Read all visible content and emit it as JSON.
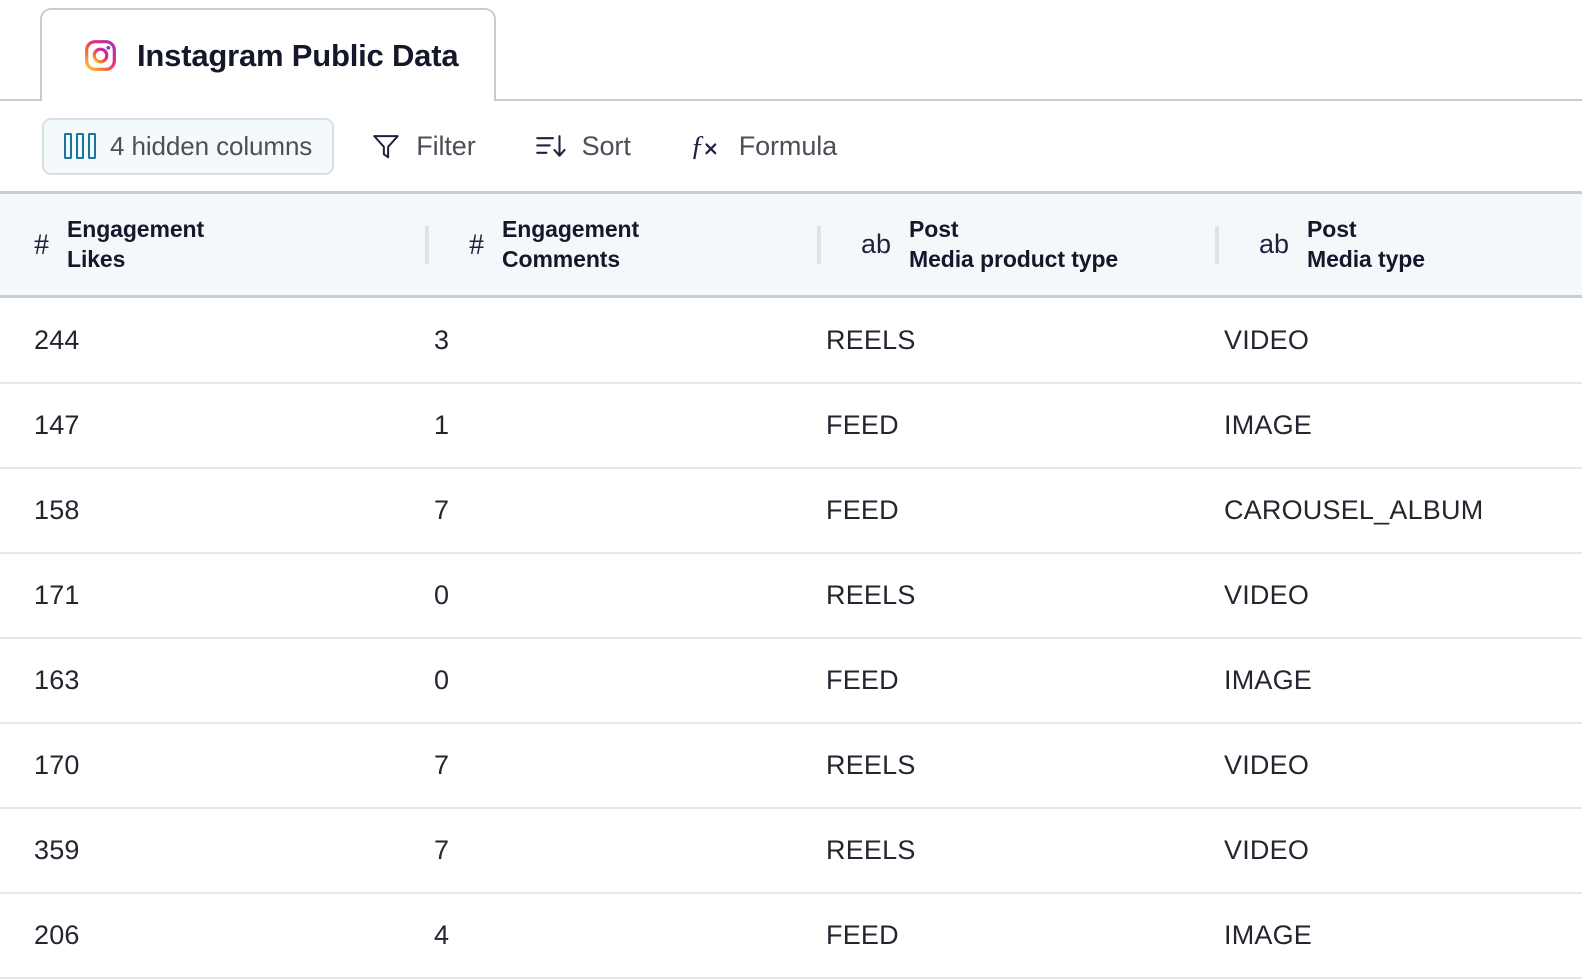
{
  "tab": {
    "title": "Instagram Public Data",
    "icon": "instagram-icon"
  },
  "toolbar": {
    "hidden_columns": {
      "label": "4 hidden columns",
      "icon": "columns-icon",
      "active": true,
      "accent_color": "#16769e",
      "background": "#f4fafc"
    },
    "filter": {
      "label": "Filter",
      "icon": "funnel-icon"
    },
    "sort": {
      "label": "Sort",
      "icon": "sort-descending-icon"
    },
    "formula": {
      "label": "Formula",
      "icon": "function-icon"
    }
  },
  "table": {
    "columns": [
      {
        "type_icon": "#",
        "group": "Engagement",
        "name": "Likes"
      },
      {
        "type_icon": "#",
        "group": "Engagement",
        "name": "Comments"
      },
      {
        "type_icon": "ab",
        "group": "Post",
        "name": "Media product type"
      },
      {
        "type_icon": "ab",
        "group": "Post",
        "name": "Media type"
      }
    ],
    "rows": [
      {
        "likes": "244",
        "comments": "3",
        "media_product_type": "REELS",
        "media_type": "VIDEO"
      },
      {
        "likes": "147",
        "comments": "1",
        "media_product_type": "FEED",
        "media_type": "IMAGE"
      },
      {
        "likes": "158",
        "comments": "7",
        "media_product_type": "FEED",
        "media_type": "CAROUSEL_ALBUM"
      },
      {
        "likes": "171",
        "comments": "0",
        "media_product_type": "REELS",
        "media_type": "VIDEO"
      },
      {
        "likes": "163",
        "comments": "0",
        "media_product_type": "FEED",
        "media_type": "IMAGE"
      },
      {
        "likes": "170",
        "comments": "7",
        "media_product_type": "REELS",
        "media_type": "VIDEO"
      },
      {
        "likes": "359",
        "comments": "7",
        "media_product_type": "REELS",
        "media_type": "VIDEO"
      },
      {
        "likes": "206",
        "comments": "4",
        "media_product_type": "FEED",
        "media_type": "IMAGE"
      }
    ]
  }
}
